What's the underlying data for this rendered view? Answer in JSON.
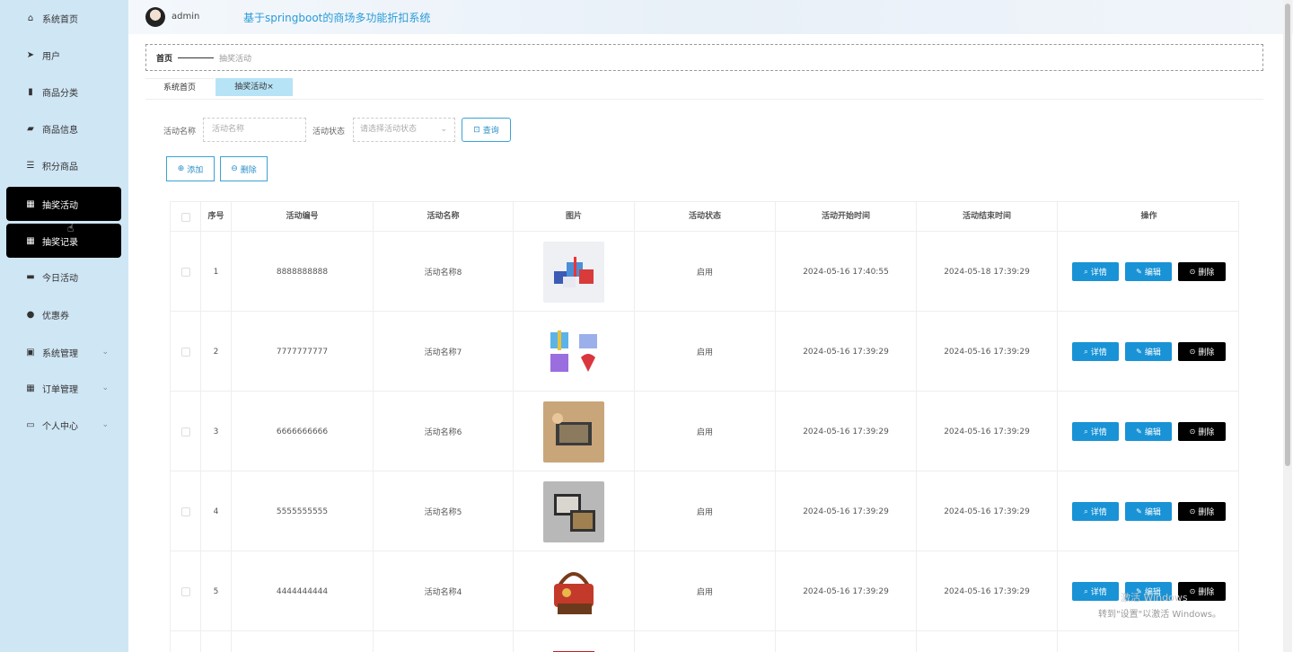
{
  "sidebar": {
    "items": [
      {
        "label": "系统首页",
        "icon": "home-icon"
      },
      {
        "label": "用户",
        "icon": "send-icon"
      },
      {
        "label": "商品分类",
        "icon": "bar-chart-icon"
      },
      {
        "label": "商品信息",
        "icon": "thumb-icon"
      },
      {
        "label": "积分商品",
        "icon": "list-icon"
      },
      {
        "label": "抽奖活动",
        "icon": "grid-icon"
      },
      {
        "label": "抽奖记录",
        "icon": "grid-icon"
      },
      {
        "label": "今日活动",
        "icon": "monitor-icon"
      },
      {
        "label": "优惠券",
        "icon": "user-icon"
      },
      {
        "label": "系统管理",
        "icon": "chart-icon"
      },
      {
        "label": "订单管理",
        "icon": "grid-icon"
      },
      {
        "label": "个人中心",
        "icon": "calendar-icon"
      }
    ]
  },
  "header": {
    "username": "admin",
    "title": "基于springboot的商场多功能折扣系统"
  },
  "breadcrumb": {
    "home": "首页",
    "current": "抽奖活动"
  },
  "tabs": [
    {
      "label": "系统首页"
    },
    {
      "label": "抽奖活动×"
    }
  ],
  "search": {
    "name_label": "活动名称",
    "name_placeholder": "活动名称",
    "status_label": "活动状态",
    "status_placeholder": "请选择活动状态",
    "query_label": "查询"
  },
  "actions": {
    "add_label": "添加",
    "delete_label": "删除"
  },
  "table": {
    "headers": [
      "序号",
      "活动编号",
      "活动名称",
      "图片",
      "活动状态",
      "活动开始时间",
      "活动结束时间",
      "操作"
    ],
    "rows": [
      {
        "no": "1",
        "code": "8888888888",
        "name": "活动名称8",
        "status": "启用",
        "start": "2024-05-16 17:40:55",
        "end": "2024-05-18 17:39:29"
      },
      {
        "no": "2",
        "code": "7777777777",
        "name": "活动名称7",
        "status": "启用",
        "start": "2024-05-16 17:39:29",
        "end": "2024-05-16 17:39:29"
      },
      {
        "no": "3",
        "code": "6666666666",
        "name": "活动名称6",
        "status": "启用",
        "start": "2024-05-16 17:39:29",
        "end": "2024-05-16 17:39:29"
      },
      {
        "no": "4",
        "code": "5555555555",
        "name": "活动名称5",
        "status": "启用",
        "start": "2024-05-16 17:39:29",
        "end": "2024-05-16 17:39:29"
      },
      {
        "no": "5",
        "code": "4444444444",
        "name": "活动名称4",
        "status": "启用",
        "start": "2024-05-16 17:39:29",
        "end": "2024-05-16 17:39:29"
      }
    ],
    "op_detail": "详情",
    "op_edit": "编辑",
    "op_delete": "删除"
  },
  "watermark": {
    "line1": "激活 Windows",
    "line2": "转到\"设置\"以激活 Windows。"
  },
  "colors": {
    "sidebar_bg": "#cfe6f5",
    "active_bg": "#000000",
    "primary": "#1993d6",
    "tab_active": "#b7e3f7"
  }
}
